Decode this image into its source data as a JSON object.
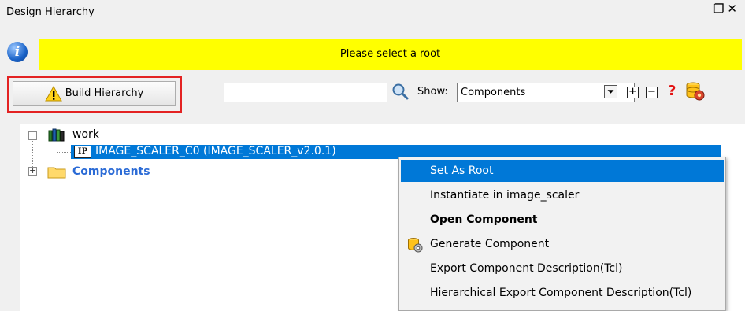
{
  "window": {
    "title": "Design Hierarchy",
    "controls": [
      "restore-icon",
      "close-icon"
    ],
    "restore_glyph": "❐",
    "close_glyph": "✕"
  },
  "info_bar": {
    "icon": "info-icon",
    "icon_glyph": "i",
    "message": "Please select a root",
    "background": "#ffff00"
  },
  "toolbar": {
    "build_label": "Build Hierarchy",
    "build_icon": "warning-icon",
    "search_value": "",
    "show_label": "Show:",
    "show_value": "Components",
    "expand_glyph": "+",
    "collapse_glyph": "−",
    "help_glyph": "?"
  },
  "tree": {
    "nodes": [
      {
        "label": "work",
        "icon": "library-icon",
        "expanded": true,
        "expander_glyph": "−"
      },
      {
        "label": "IMAGE_SCALER_C0 (IMAGE_SCALER_v2.0.1)",
        "icon": "ip-icon",
        "icon_text": "IP",
        "selected": true
      },
      {
        "label": "Components",
        "icon": "folder-icon",
        "expanded": false,
        "expander_glyph": "+"
      }
    ]
  },
  "context_menu": {
    "items": [
      {
        "label": "Set As Root",
        "active": true
      },
      {
        "label": "Instantiate in image_scaler"
      },
      {
        "label": "Open Component",
        "bold": true
      },
      {
        "label": "Generate Component",
        "icon": "generate-icon"
      },
      {
        "label": "Export Component Description(Tcl)"
      },
      {
        "label": "Hierarchical Export Component Description(Tcl)"
      }
    ]
  },
  "colors": {
    "highlight": "#0078d7",
    "outline_red": "#e32222",
    "link_blue": "#2b6bd6"
  }
}
